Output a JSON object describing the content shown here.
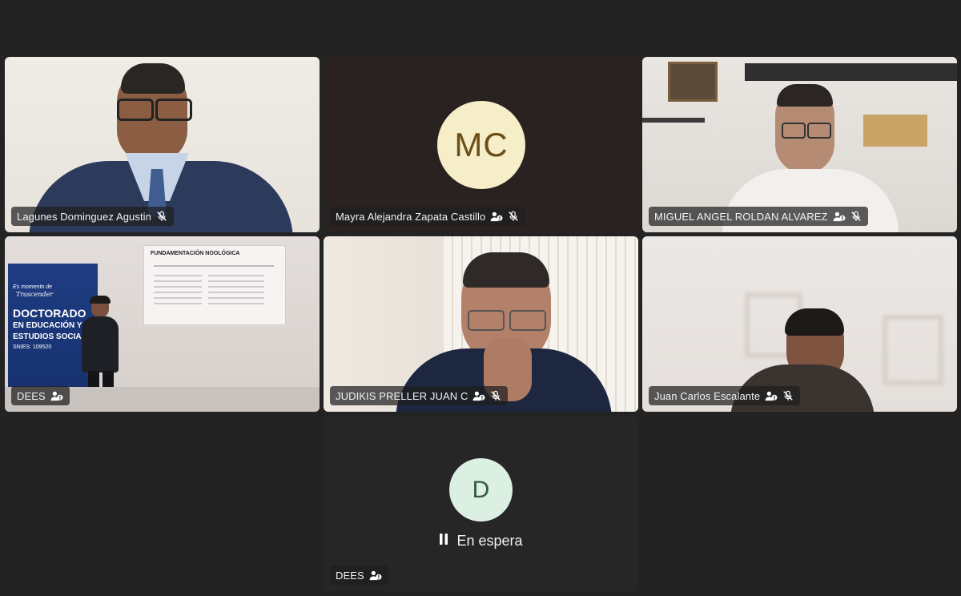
{
  "participants": [
    {
      "name": "Lagunes Dominguez Agustin"
    },
    {
      "name": "Mayra Alejandra Zapata Castillo",
      "avatar_initials": "MC"
    },
    {
      "name": "MIGUEL ANGEL ROLDAN ALVAREZ"
    },
    {
      "name": "DEES",
      "screen_text": [
        "Es momento de",
        "Trascender",
        "DOCTORADO",
        "EN EDUCACIÓN Y",
        "ESTUDIOS SOCIALES",
        "SNIES: 109520",
        "FUNDAMENTACIÓN NOOLÓGICA"
      ]
    },
    {
      "name": "JUDIKIS PRELLER JUAN C"
    },
    {
      "name": "Juan Carlos Escalante"
    },
    {
      "name": "DEES",
      "avatar_initials": "D",
      "status": "En espera"
    }
  ],
  "colors": {
    "background": "#232323",
    "active_outline": "#8a8cf5",
    "avatar_mc_bg": "#f6edc9",
    "avatar_mc_text": "#6b4f1a",
    "avatar_d_bg": "#dcefe3",
    "avatar_d_text": "#2f5b3f"
  },
  "icons": [
    "mic-muted-icon",
    "raised-hand-icon",
    "pause-icon"
  ]
}
